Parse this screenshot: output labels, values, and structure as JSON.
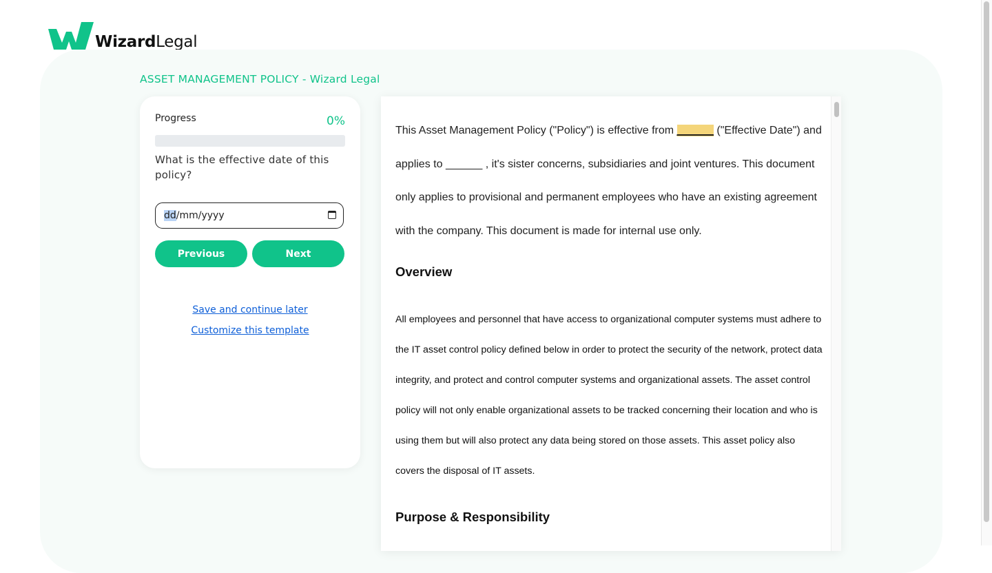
{
  "brand": {
    "name_bold": "Wizard",
    "name_rest": "Legal",
    "color": "#10c38a"
  },
  "document_title": "ASSET MANAGEMENT POLICY - Wizard Legal",
  "progress": {
    "label": "Progress",
    "percent_text": "0%",
    "value": 0
  },
  "question": "What is the effective date of this policy?",
  "date_input": {
    "day": "dd",
    "rest": "/mm/yyyy",
    "icon": "calendar-icon"
  },
  "buttons": {
    "previous": "Previous",
    "next": "Next"
  },
  "links": {
    "save": "Save and continue later",
    "customize": "Customize this template"
  },
  "document": {
    "intro": {
      "part1": "This Asset Management Policy (\"Policy\") is effective from ",
      "blank_highlighted": "______",
      "part2": " (\"Effective Date\") and applies to ",
      "blank2": "______",
      "part3": " , it's sister concerns, subsidiaries and joint ventures. This document only applies to provisional and permanent employees who have an existing agreement with the company. This document is made for internal use only."
    },
    "overview_heading": "Overview",
    "overview_text": "All employees and personnel that have access to organizational computer systems must adhere to the IT asset control policy defined below in order to protect the security of the network, protect data integrity, and protect and control computer systems and organizational assets. The asset control policy will not only enable organizational assets to be tracked concerning their location and who is using them but will also protect any data being stored on those assets. This asset policy also covers the disposal of IT assets.",
    "purpose_heading": "Purpose & Responsibility"
  }
}
